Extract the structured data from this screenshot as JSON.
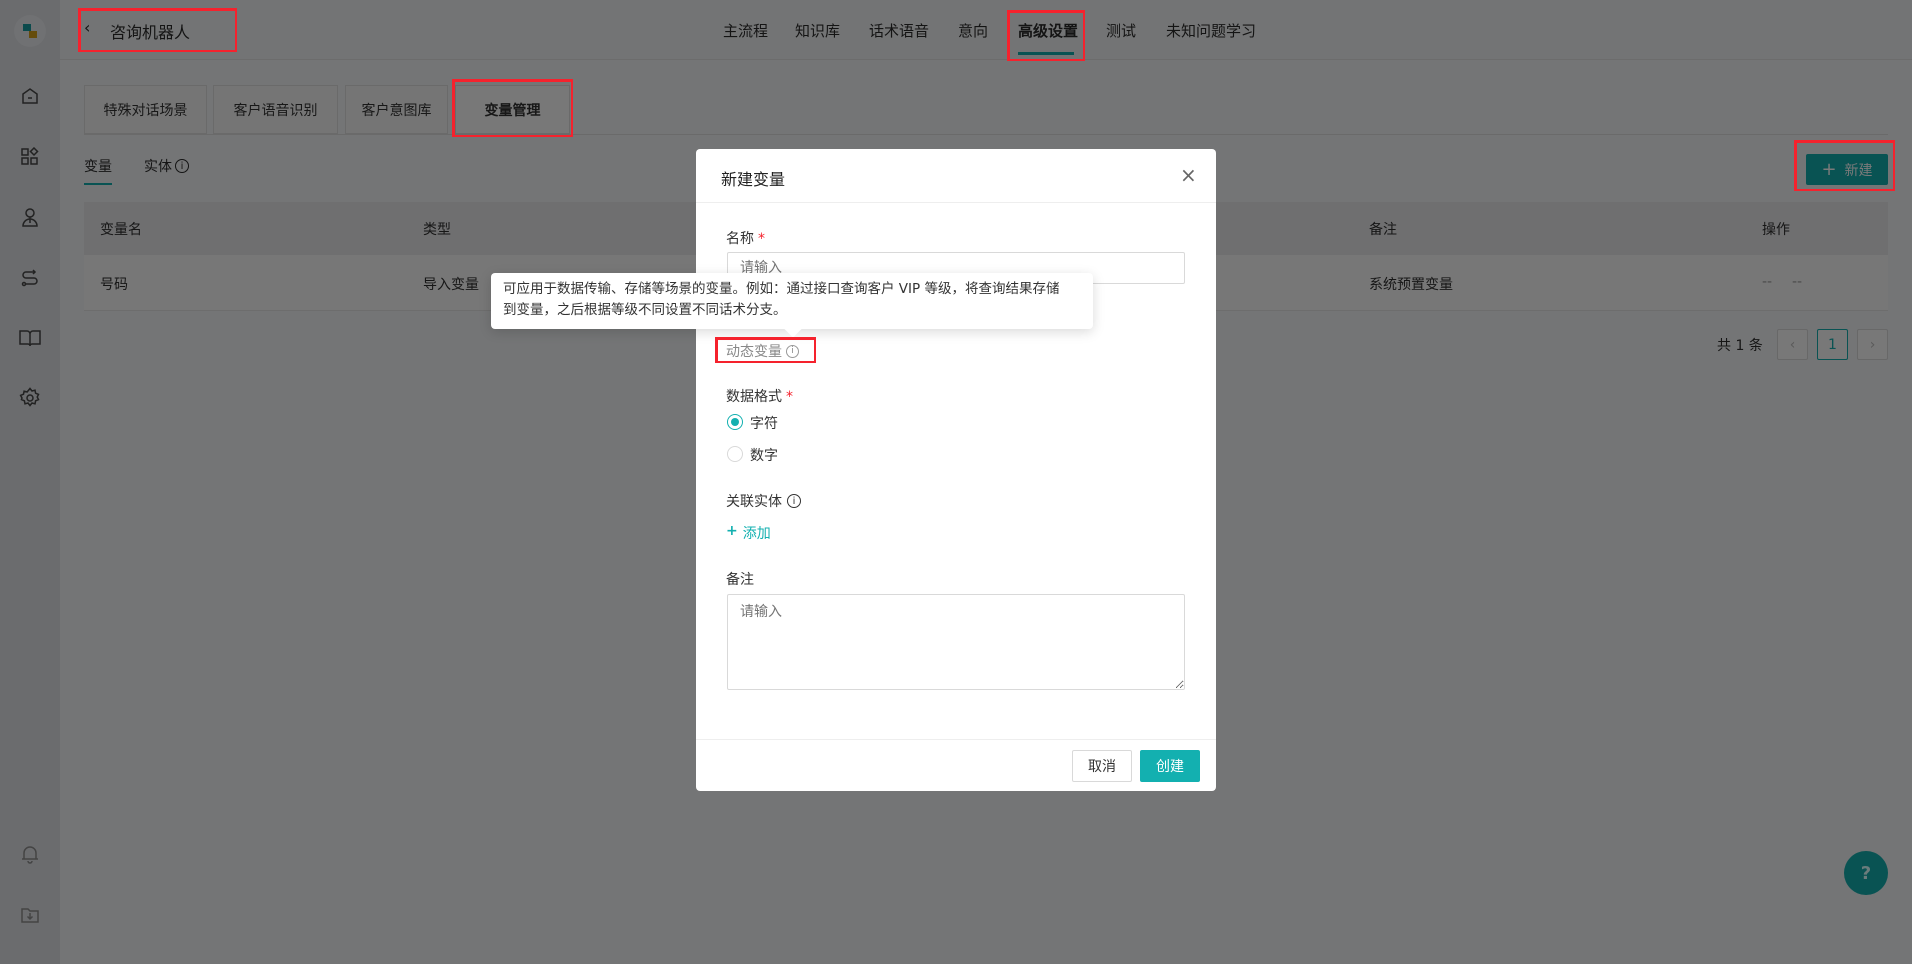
{
  "app": {
    "title": "咨询机器人",
    "back_icon": "chevron-left-icon"
  },
  "sidebar": {
    "icons": [
      "logo",
      "home-icon",
      "apps-icon",
      "robot-icon",
      "flow-icon",
      "book-icon",
      "gear-icon",
      "bell-icon",
      "download-folder-icon"
    ]
  },
  "nav": {
    "items": [
      "主流程",
      "知识库",
      "话术语音",
      "意向",
      "高级设置",
      "测试",
      "未知问题学习"
    ],
    "active": "高级设置"
  },
  "subtabs": {
    "items": [
      "特殊对话场景",
      "客户语音识别",
      "客户意图库",
      "变量管理"
    ],
    "active": "变量管理"
  },
  "inner_tabs": {
    "items": [
      "变量",
      "实体"
    ],
    "active": "变量"
  },
  "toolbar": {
    "new_label": "新建"
  },
  "table": {
    "headers": [
      "变量名",
      "类型",
      "备注",
      "操作"
    ],
    "rows": [
      {
        "name": "号码",
        "type": "导入变量",
        "note": "系统预置变量",
        "ops": [
          "--",
          "--"
        ]
      }
    ]
  },
  "pagination": {
    "total": "共 1 条",
    "current": "1"
  },
  "modal": {
    "title": "新建变量",
    "name_label": "名称",
    "name_placeholder": "请输入",
    "type_label": "动态变量",
    "format_label": "数据格式",
    "format_options": [
      "字符",
      "数字"
    ],
    "format_selected": "字符",
    "entity_label": "关联实体",
    "add_label": "添加",
    "note_label": "备注",
    "note_placeholder": "请输入",
    "cancel_label": "取消",
    "create_label": "创建"
  },
  "tooltip": {
    "line1": "可应用于数据传输、存储等场景的变量。例如：通过接口查询客户 VIP 等级，将查询结果存储",
    "line2": "到变量，之后根据等级不同设置不同话术分支。"
  },
  "colors": {
    "accent": "#13b0b0",
    "annotation": "#f5222d"
  }
}
